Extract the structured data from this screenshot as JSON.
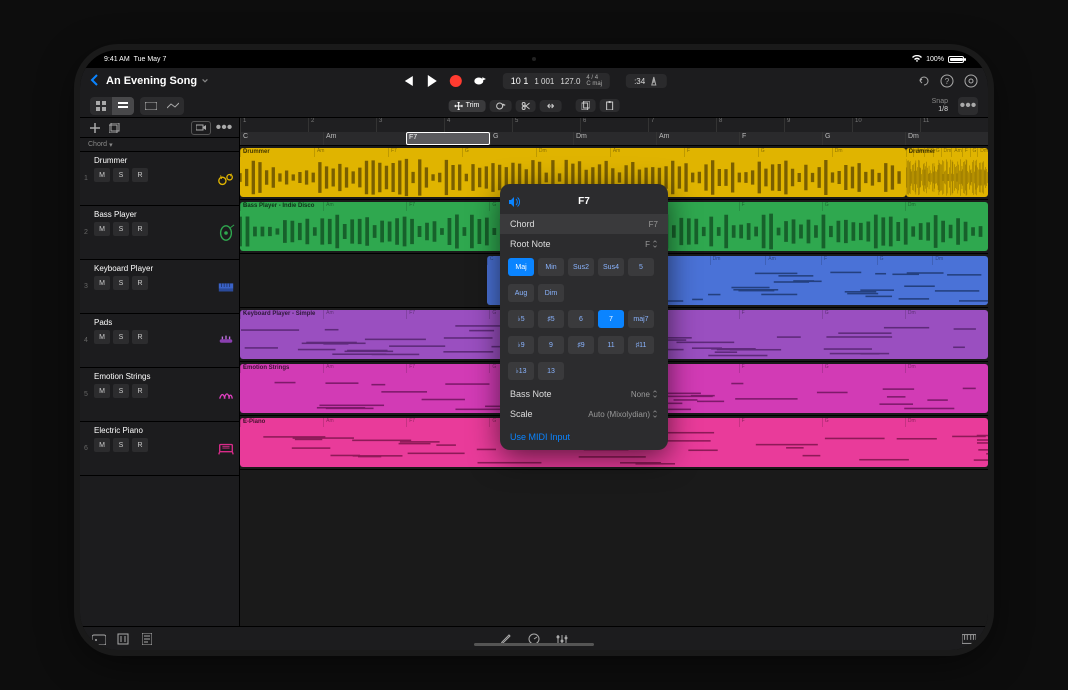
{
  "status": {
    "time": "9:41 AM",
    "date": "Tue May 7",
    "battery": "100%"
  },
  "project": {
    "title": "An Evening Song"
  },
  "transport": {
    "bars": "10 1",
    "beats": "1 001",
    "tempo": "127.0",
    "sig_top": "4 / 4",
    "sig_bot": "C maj",
    "count": ":34"
  },
  "toolbar": {
    "trim": "Trim",
    "snap_label": "Snap",
    "snap_value": "1/8"
  },
  "side": {
    "chord_label": "Chord"
  },
  "tracks": [
    {
      "num": "1",
      "name": "Drummer",
      "color": "#e0b400"
    },
    {
      "num": "2",
      "name": "Bass Player",
      "color": "#2fa84f"
    },
    {
      "num": "3",
      "name": "Keyboard Player",
      "color": "#3a62c7"
    },
    {
      "num": "4",
      "name": "Pads",
      "color": "#8a3fb0"
    },
    {
      "num": "5",
      "name": "Emotion Strings",
      "color": "#c22ba5"
    },
    {
      "num": "6",
      "name": "Electric Piano",
      "color": "#d92b8a"
    }
  ],
  "msr": {
    "m": "M",
    "s": "S",
    "r": "R"
  },
  "ruler": [
    "1",
    "2",
    "3",
    "4",
    "5",
    "6",
    "7",
    "8",
    "9",
    "10",
    "11"
  ],
  "chords": [
    "C",
    "Am",
    "F7",
    "G",
    "Dm",
    "Am",
    "F",
    "G",
    "Dm"
  ],
  "chord_sel_index": 2,
  "region_labels": {
    "drummer": "Drummer",
    "drummer2": "Drummer",
    "bass": "Bass Player - Indie Disco",
    "keys": "Keyboard Player - Simple",
    "emotion": "Emotion Strings",
    "epiano": "E-Piano"
  },
  "popover": {
    "title": "F7",
    "chord_label": "Chord",
    "chord_value": "F7",
    "root_label": "Root Note",
    "root_value": "F",
    "qualities_row1": [
      "Maj",
      "Min",
      "Sus2",
      "Sus4",
      "5"
    ],
    "qualities_row2": [
      "Aug",
      "Dim"
    ],
    "ext_row1": [
      "♭5",
      "♯5",
      "6",
      "7",
      "maj7"
    ],
    "ext_row2": [
      "♭9",
      "9",
      "♯9",
      "11",
      "♯11"
    ],
    "ext_row3": [
      "♭13",
      "13"
    ],
    "quality_selected": "Maj",
    "ext_selected": "7",
    "bass_label": "Bass Note",
    "bass_value": "None",
    "scale_label": "Scale",
    "scale_value": "Auto (Mixolydian)",
    "midi_link": "Use MIDI Input"
  }
}
